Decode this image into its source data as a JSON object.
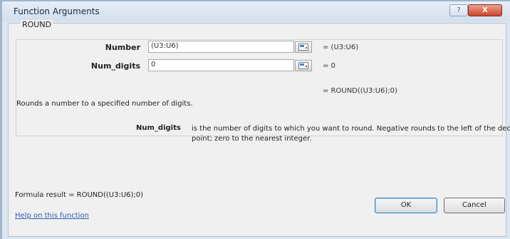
{
  "window": {
    "title": "Function Arguments",
    "help_glyph": "?",
    "close_glyph": "X"
  },
  "function_name": "ROUND",
  "arguments": [
    {
      "label": "Number",
      "value": "(U3:U6)",
      "result": "=  (U3:U6)"
    },
    {
      "label": "Num_digits",
      "value": "0",
      "result": "=  0"
    }
  ],
  "overall_result": "=  ROUND((U3:U6);0)",
  "description": "Rounds a number to a specified number of digits.",
  "arg_help": {
    "name": "Num_digits",
    "text": "is the number of digits to which you want to round. Negative rounds to the left of the decimal point; zero to the nearest integer."
  },
  "formula_result": "Formula result =  ROUND((U3:U6);0)",
  "help_link": "Help on this function",
  "buttons": {
    "ok": "OK",
    "cancel": "Cancel"
  },
  "colors": {
    "link": "#2a5db0",
    "titlebar": "#dbe6f1",
    "close": "#c9452a"
  },
  "icons": [
    "collapse-dialog-icon",
    "help-icon",
    "close-icon"
  ]
}
